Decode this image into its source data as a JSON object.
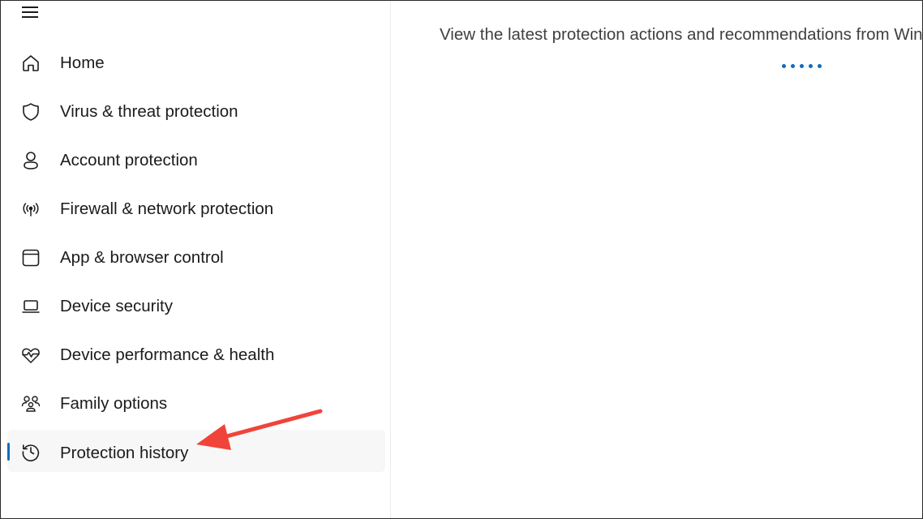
{
  "sidebar": {
    "items": [
      {
        "label": "Home",
        "icon": "home-icon"
      },
      {
        "label": "Virus & threat protection",
        "icon": "shield-icon"
      },
      {
        "label": "Account protection",
        "icon": "person-icon"
      },
      {
        "label": "Firewall & network protection",
        "icon": "wifi-antenna-icon"
      },
      {
        "label": "App & browser control",
        "icon": "app-window-icon"
      },
      {
        "label": "Device security",
        "icon": "laptop-icon"
      },
      {
        "label": "Device performance & health",
        "icon": "heart-pulse-icon"
      },
      {
        "label": "Family options",
        "icon": "family-icon"
      },
      {
        "label": "Protection history",
        "icon": "history-icon",
        "selected": true
      }
    ]
  },
  "main": {
    "subtitle": "View the latest protection actions and recommendations from Windows Security."
  },
  "colors": {
    "accent": "#0f6cbd",
    "annotation_arrow": "#f0443a"
  }
}
